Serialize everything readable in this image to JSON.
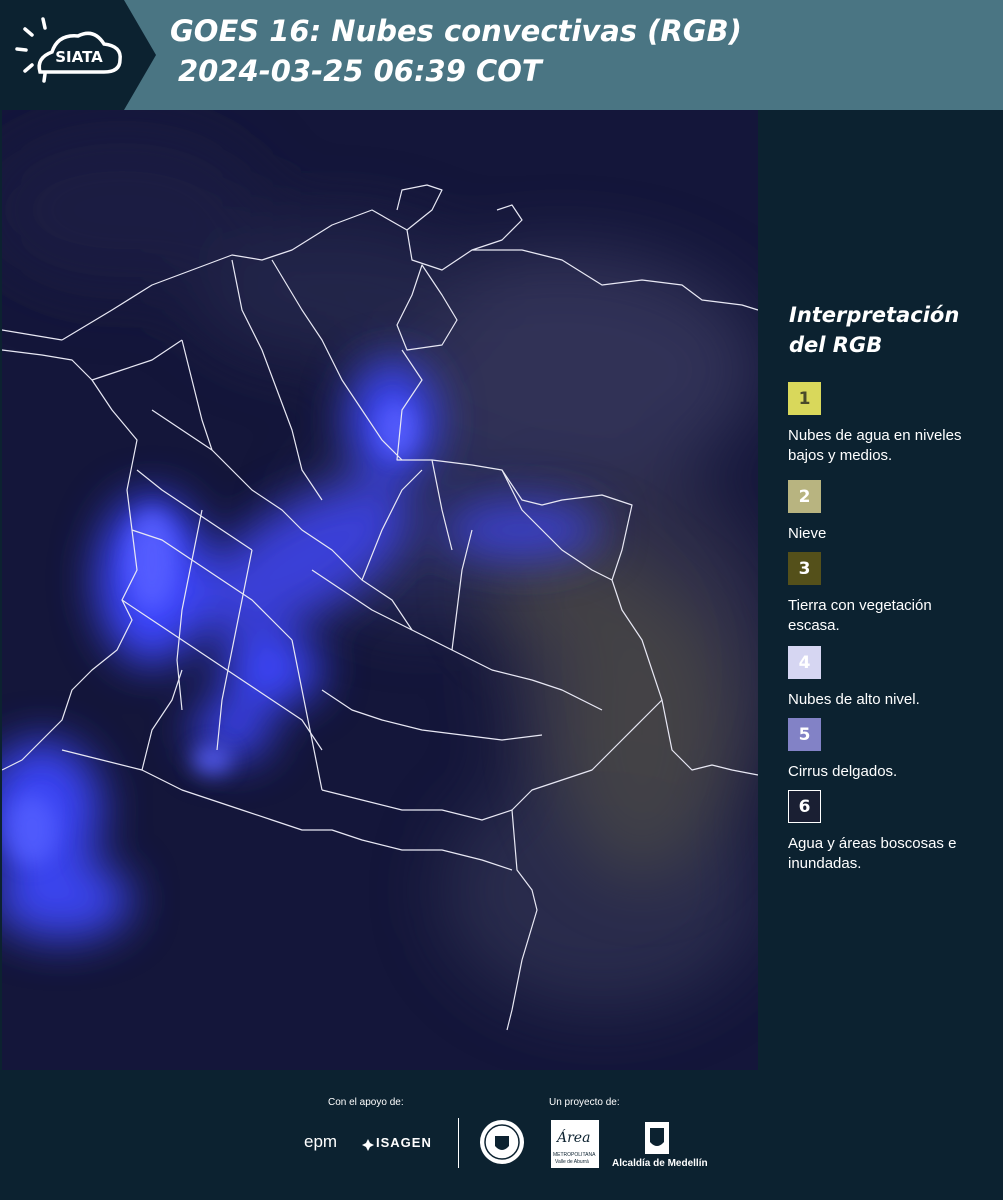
{
  "header": {
    "logo_text": "SIATA",
    "title_line1": "GOES 16: Nubes convectivas (RGB)",
    "title_line2": "2024-03-25 06:39 COT"
  },
  "legend": {
    "title": "Interpretación del RGB",
    "items": [
      {
        "number": "1",
        "label": "Nubes de agua en niveles bajos y medios.",
        "color": "#d9d85b",
        "text_color": "#4a4a2a"
      },
      {
        "number": "2",
        "label": "Nieve",
        "color": "#b8b480",
        "text_color": "#ffffff"
      },
      {
        "number": "3",
        "label": "Tierra con vegetación escasa.",
        "color": "#54501a",
        "text_color": "#ffffff"
      },
      {
        "number": "4",
        "label": "Nubes de alto nivel.",
        "color": "#d6d6f2",
        "text_color": "#ffffff"
      },
      {
        "number": "5",
        "label": "Cirrus delgados.",
        "color": "#8282c6",
        "text_color": "#ffffff"
      },
      {
        "number": "6",
        "label": "Agua y áreas boscosas e inundadas.",
        "color": "#1a1f33",
        "text_color": "#ffffff"
      }
    ]
  },
  "footer": {
    "support_label": "Con el apoyo de:",
    "project_label": "Un proyecto de:",
    "sponsor1": "epm",
    "sponsor2": "ISAGEN",
    "partner2_main": "Área",
    "partner2_sub1": "METROPOLITANA",
    "partner2_sub2": "Valle de Aburrá",
    "partner3": "Alcaldía de Medellín"
  },
  "map": {
    "background_color": "#14163a",
    "convective_cloud_color": "#3c46ff",
    "boundary_color": "#e8e8f4"
  }
}
